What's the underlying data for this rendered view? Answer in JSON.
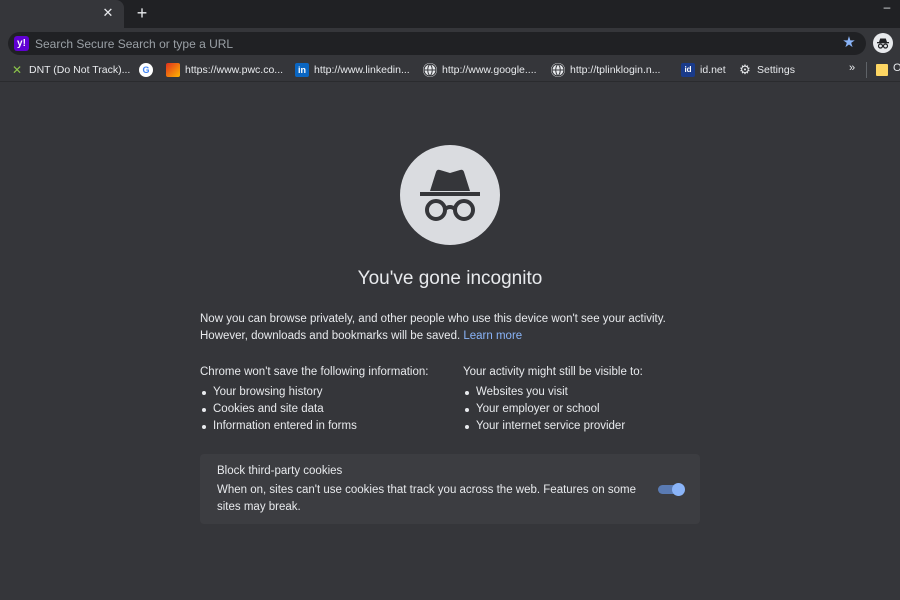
{
  "tabstrip": {
    "close_glyph": "✕",
    "newtab_glyph": "+",
    "minimize_glyph": "–"
  },
  "omnibox": {
    "placeholder": "Search Secure Search or type a URL",
    "search_engine_icon": "yahoo-icon",
    "search_engine_glyph": "y!",
    "star_glyph": "★",
    "accent_color": "#8ab4f8"
  },
  "bookmarks": {
    "items": [
      {
        "label": "DNT (Do Not Track)...",
        "icon": "dnt-icon",
        "glyph": "✕"
      },
      {
        "label": "",
        "icon": "google-icon",
        "glyph": "G"
      },
      {
        "label": "https://www.pwc.co...",
        "icon": "pwc-icon",
        "glyph": ""
      },
      {
        "label": "http://www.linkedin...",
        "icon": "linkedin-icon",
        "glyph": "in"
      },
      {
        "label": "http://www.google....",
        "icon": "globe-icon",
        "glyph": "🌐"
      },
      {
        "label": "http://tplinklogin.n...",
        "icon": "globe-icon",
        "glyph": "🌐"
      },
      {
        "label": "id.net",
        "icon": "idnet-icon",
        "glyph": "id"
      },
      {
        "label": "Settings",
        "icon": "gear-icon",
        "glyph": "⚙"
      }
    ],
    "more_glyph": "»",
    "other_label": "O"
  },
  "incognito": {
    "title": "You've gone incognito",
    "intro_text": "Now you can browse privately, and other people who use this device won't see your activity. However, downloads and bookmarks will be saved.",
    "learn_more": "Learn more",
    "not_saved": {
      "heading": "Chrome won't save the following information:",
      "items": [
        "Your browsing history",
        "Cookies and site data",
        "Information entered in forms"
      ]
    },
    "still_visible": {
      "heading": "Your activity might still be visible to:",
      "items": [
        "Websites you visit",
        "Your employer or school",
        "Your internet service provider"
      ]
    },
    "cookie_card": {
      "title": "Block third-party cookies",
      "description": "When on, sites can't use cookies that track you across the web. Features on some sites may break.",
      "toggle_on": true
    }
  }
}
